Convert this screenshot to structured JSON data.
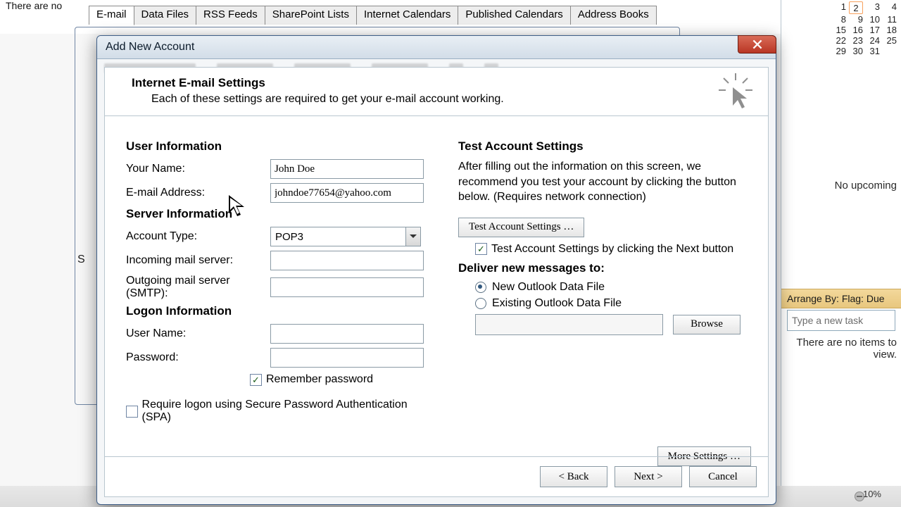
{
  "bg": {
    "empty_text": "There are no",
    "tabs": [
      "E-mail",
      "Data Files",
      "RSS Feeds",
      "SharePoint Lists",
      "Internet Calendars",
      "Published Calendars",
      "Address Books"
    ],
    "outer_initial": "S",
    "zoom": "10%"
  },
  "rpane": {
    "cal_rows": [
      [
        "1",
        "2",
        "3",
        "4"
      ],
      [
        "8",
        "9",
        "10",
        "11"
      ],
      [
        "15",
        "16",
        "17",
        "18"
      ],
      [
        "22",
        "23",
        "24",
        "25"
      ],
      [
        "29",
        "30",
        "31",
        ""
      ]
    ],
    "cal_selected": "2",
    "upcoming": "No upcoming",
    "arrange": "Arrange By: Flag: Due",
    "newtask_placeholder": "Type a new task",
    "noitems_1": "There are no items to",
    "noitems_2": "view."
  },
  "dlg": {
    "title": "Add New Account",
    "heading": "Internet E-mail Settings",
    "subheading": "Each of these settings are required to get your e-mail account working.",
    "sec_user": "User Information",
    "lbl_yourname": "Your Name:",
    "val_yourname": "John Doe",
    "lbl_email": "E-mail Address:",
    "val_email": "johndoe77654@yahoo.com",
    "sec_server": "Server Information",
    "lbl_accttype": "Account Type:",
    "val_accttype": "POP3",
    "lbl_incoming": "Incoming mail server:",
    "val_incoming": "",
    "lbl_outgoing": "Outgoing mail server (SMTP):",
    "val_outgoing": "",
    "sec_logon": "Logon Information",
    "lbl_user": "User Name:",
    "val_user": "",
    "lbl_pass": "Password:",
    "val_pass": "",
    "chk_remember": "Remember password",
    "chk_spa": "Require logon using Secure Password Authentication (SPA)",
    "sec_test": "Test Account Settings",
    "test_para": "After filling out the information on this screen, we recommend you test your account by clicking the button below. (Requires network connection)",
    "btn_test": "Test Account Settings …",
    "chk_testnext": "Test Account Settings by clicking the Next button",
    "sec_deliver": "Deliver new messages to:",
    "radio_new": "New Outlook Data File",
    "radio_existing": "Existing Outlook Data File",
    "btn_browse": "Browse",
    "btn_more": "More Settings …",
    "btn_back": "< Back",
    "btn_next": "Next >",
    "btn_cancel": "Cancel"
  }
}
